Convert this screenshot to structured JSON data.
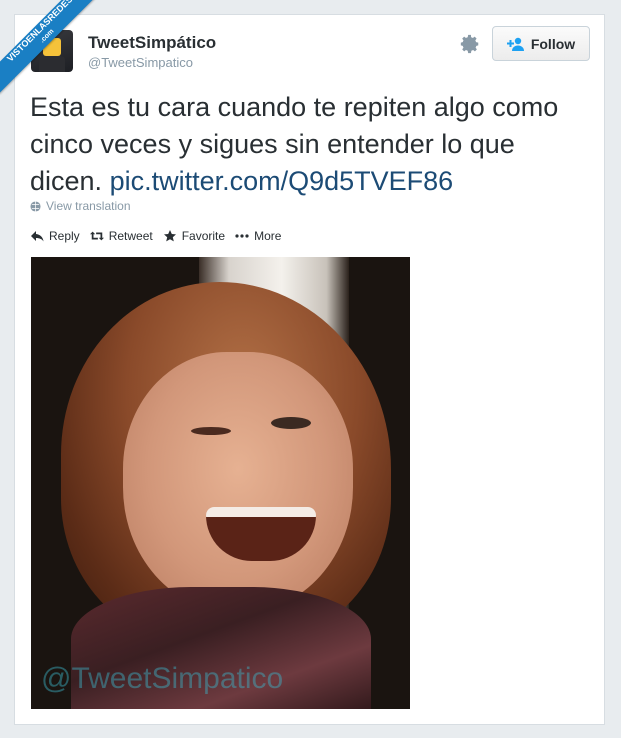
{
  "ribbon": {
    "text": "VISTOENLASREDES",
    "sub": ".com"
  },
  "user": {
    "name": "TweetSimpático",
    "handle": "@TweetSimpatico"
  },
  "follow_button": {
    "label": "Follow",
    "icon": "add-user-icon"
  },
  "settings_icon": "gear-icon",
  "tweet": {
    "text": "Esta es tu cara cuando te repiten algo como cinco veces y sigues sin entender lo que dicen. ",
    "link": "pic.twitter.com/Q9d5TVEF86"
  },
  "translation": {
    "label": "View translation",
    "icon": "globe-icon"
  },
  "actions": {
    "reply": "Reply",
    "retweet": "Retweet",
    "favorite": "Favorite",
    "more": "More"
  },
  "photo": {
    "watermark": "@TweetSimpatico"
  },
  "colors": {
    "ribbon": "#1a7fc4",
    "link": "#1c4b75",
    "secondary_text": "#8899a6"
  }
}
